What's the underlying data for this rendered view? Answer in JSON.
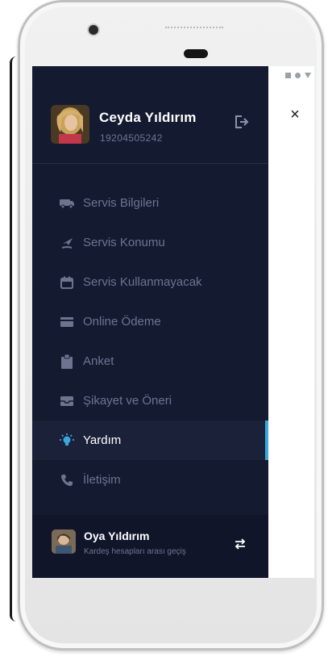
{
  "drawer": {
    "user": {
      "name": "Ceyda Yıldırım",
      "phone": "19204505242"
    },
    "menu": [
      {
        "label": "Servis Bilgileri",
        "icon": "bus-icon",
        "active": false
      },
      {
        "label": "Servis Konumu",
        "icon": "location-pin-icon",
        "active": false
      },
      {
        "label": "Servis Kullanmayacak",
        "icon": "calendar-icon",
        "active": false
      },
      {
        "label": "Online Ödeme",
        "icon": "credit-card-icon",
        "active": false
      },
      {
        "label": "Anket",
        "icon": "clipboard-icon",
        "active": false
      },
      {
        "label": "Şikayet ve Öneri",
        "icon": "inbox-icon",
        "active": false
      },
      {
        "label": "Yardım",
        "icon": "lightbulb-icon",
        "active": true
      },
      {
        "label": "İletişim",
        "icon": "phone-icon",
        "active": false
      }
    ],
    "footer": {
      "name": "Oya Yıldırım",
      "subtitle": "Kardeş hesapları arası geçiş"
    }
  },
  "colors": {
    "drawer_bg": "#141a30",
    "active_accent": "#3aa6dd",
    "muted_text": "#6d7490",
    "active_icon": "#3aa6dd"
  },
  "close_label": "×"
}
